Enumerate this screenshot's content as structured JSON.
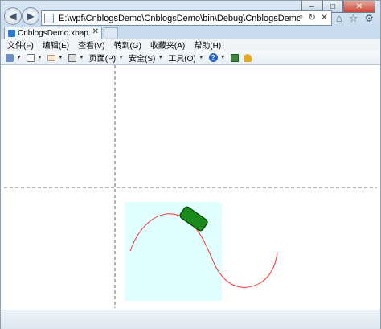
{
  "window": {
    "minimize_glyph": "–",
    "maximize_glyph": "□",
    "close_glyph": "✕"
  },
  "navigation": {
    "back_glyph": "◀",
    "forward_glyph": "▶",
    "address_value": "E:\\wpf\\CnblogsDemo\\CnblogsDemo\\bin\\Debug\\CnblogsDemo.xbap",
    "search_glyph": "⌕",
    "refresh_glyph": "↻",
    "stop_glyph": "✕"
  },
  "right_icons": {
    "home_glyph": "⌂",
    "favorites_glyph": "☆",
    "tools_glyph": "⚙"
  },
  "tab": {
    "title": "CnblogsDemo.xbap",
    "close_glyph": "✕"
  },
  "menu": {
    "items": [
      "文件(F)",
      "编辑(E)",
      "查看(V)",
      "转到(G)",
      "收藏夹(A)",
      "帮助(H)"
    ]
  },
  "toolbar": {
    "page_label": "页面(P)",
    "safety_label": "安全(S)",
    "tools_label": "工具(O)",
    "help_glyph": "?"
  },
  "canvas": {
    "background": "#ffffff",
    "guide_color": "#666666",
    "panel_color": "#e0ffff",
    "curve_color": "#ff3333",
    "block_fill": "#1a8a1a",
    "block_stroke": "#004400"
  }
}
